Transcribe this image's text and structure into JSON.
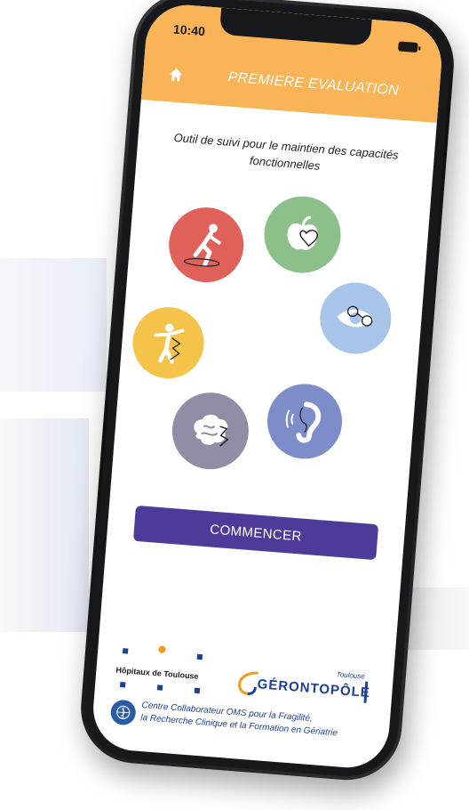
{
  "status_bar": {
    "time": "10:40"
  },
  "header": {
    "title": "PREMIERE EVALUATION"
  },
  "intro": {
    "line1": "Outil de suivi pour le maintien des capacités",
    "line2": "fonctionnelles"
  },
  "actions": {
    "start_label": "COMMENCER"
  },
  "footer": {
    "hospital_name": "Hôpitaux de Toulouse",
    "geronto_city": "Toulouse",
    "geronto_name": "GÉRONTOPÔLE",
    "who_line1": "Centre Collaborateur OMS pour la Fragilité,",
    "who_line2": "la Recherche Clinique et la Formation en Gériatrie"
  },
  "colors": {
    "header": "#f8b457",
    "button": "#4f3a99",
    "mobility": "#e0615a",
    "nutrition": "#8cc08a",
    "vision": "#a9c4ea",
    "hearing": "#7c8dc9",
    "cognition": "#8e8ea6",
    "psychology": "#f6c34a"
  },
  "icons": [
    "home-icon",
    "mobility-icon",
    "nutrition-icon",
    "vision-icon",
    "hearing-icon",
    "cognition-icon",
    "psychology-icon"
  ]
}
